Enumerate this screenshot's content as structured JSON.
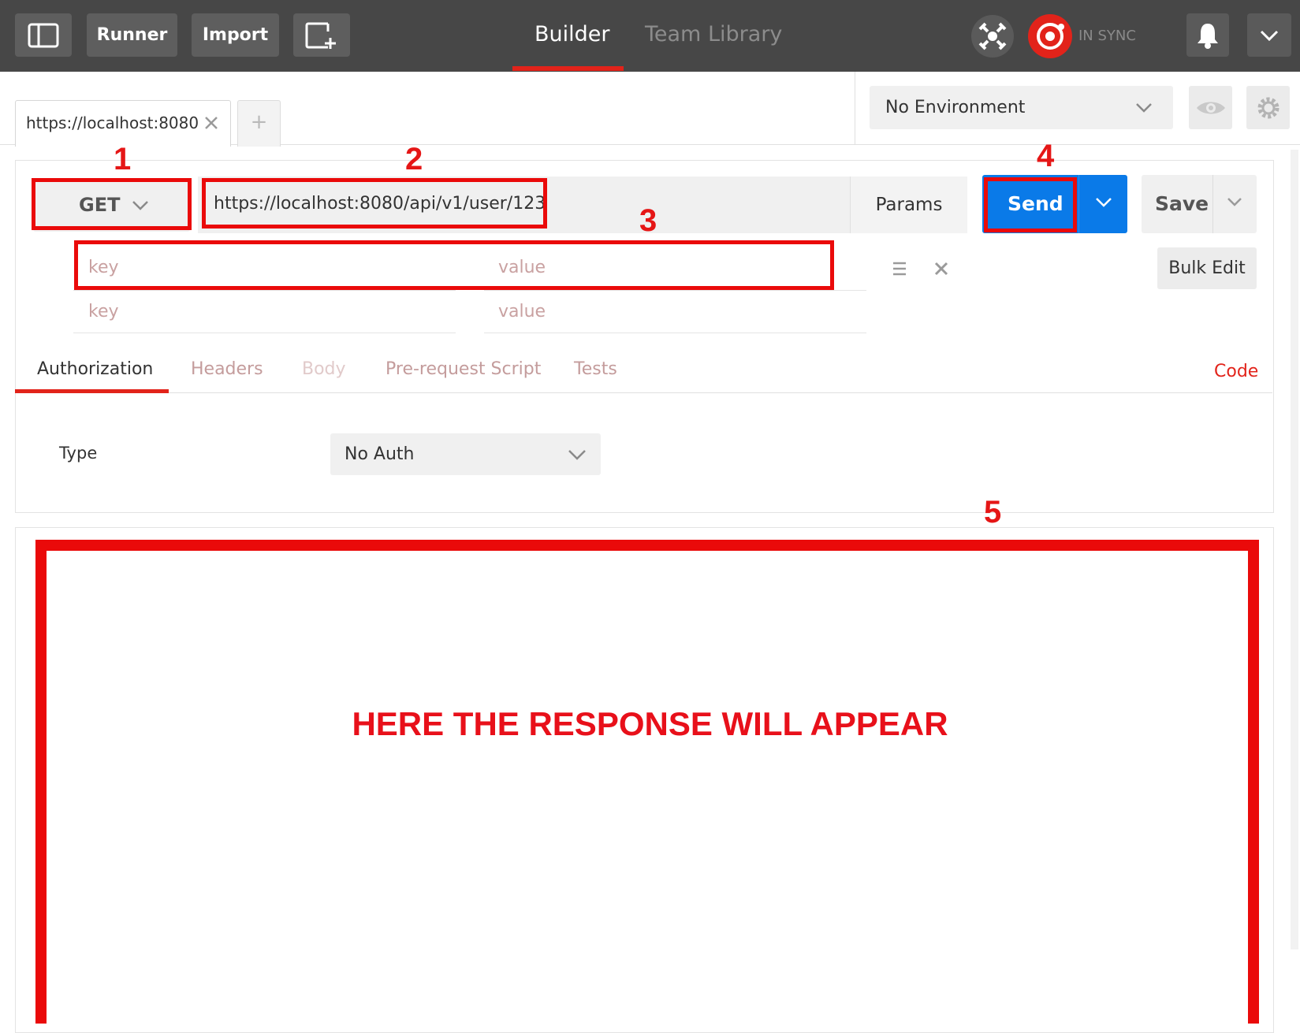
{
  "topbar": {
    "runner_label": "Runner",
    "import_label": "Import",
    "tabs": [
      {
        "label": "Builder",
        "active": true
      },
      {
        "label": "Team Library",
        "active": false
      }
    ],
    "sync_status": "IN SYNC"
  },
  "request_tabs": [
    {
      "label": "https://localhost:8080"
    }
  ],
  "environment": {
    "selected": "No Environment"
  },
  "request": {
    "method": "GET",
    "url": "https://localhost:8080/api/v1/user/123",
    "params_label": "Params",
    "send_label": "Send",
    "save_label": "Save",
    "param_rows": [
      {
        "key_placeholder": "key",
        "value_placeholder": "value"
      },
      {
        "key_placeholder": "key",
        "value_placeholder": "value"
      }
    ],
    "bulk_edit_label": "Bulk Edit"
  },
  "subtabs": [
    {
      "label": "Authorization",
      "active": true
    },
    {
      "label": "Headers",
      "active": false
    },
    {
      "label": "Body",
      "active": false
    },
    {
      "label": "Pre-request Script",
      "active": false
    },
    {
      "label": "Tests",
      "active": false
    }
  ],
  "code_link": "Code",
  "auth": {
    "type_label": "Type",
    "type_value": "No Auth"
  },
  "annotations": {
    "numbers": [
      "1",
      "2",
      "3",
      "4",
      "5"
    ],
    "response_message": "HERE THE RESPONSE WILL APPEAR"
  },
  "colors": {
    "accent": "#e2231a",
    "send_blue": "#0a7ae8",
    "topbar": "#474747",
    "annotation_red": "#ea0a0a"
  }
}
